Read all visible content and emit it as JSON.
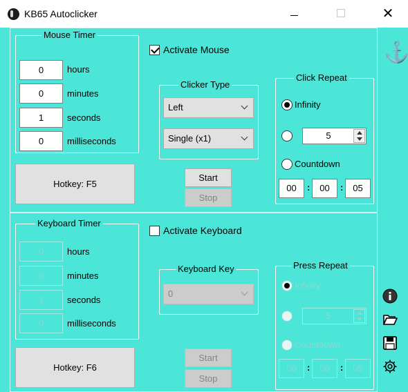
{
  "window": {
    "title": "KB65 Autoclicker",
    "close_glyph": "✕"
  },
  "mouse": {
    "timer_title": "Mouse Timer",
    "fields": [
      {
        "value": "0",
        "label": "hours"
      },
      {
        "value": "0",
        "label": "minutes"
      },
      {
        "value": "1",
        "label": "seconds"
      },
      {
        "value": "0",
        "label": "milliseconds"
      }
    ],
    "hotkey_label": "Hotkey: F5",
    "activate_label": "Activate Mouse",
    "activate_checked": true,
    "clicker_type_title": "Clicker Type",
    "button_select": "Left",
    "click_select": "Single (x1)",
    "start_label": "Start",
    "stop_label": "Stop",
    "repeat_title": "Click Repeat",
    "infinity_label": "Infinity",
    "repeat_count": "5",
    "countdown_label": "Countdown",
    "countdown": [
      "00",
      "00",
      "05"
    ],
    "time_sep": ":"
  },
  "keyboard": {
    "timer_title": "Keyboard Timer",
    "fields": [
      {
        "value": "0",
        "label": "hours"
      },
      {
        "value": "0",
        "label": "minutes"
      },
      {
        "value": "1",
        "label": "seconds"
      },
      {
        "value": "0",
        "label": "milliseconds"
      }
    ],
    "hotkey_label": "Hotkey: F6",
    "activate_label": "Activate Keyboard",
    "activate_checked": false,
    "key_title": "Keyboard Key",
    "key_select": "0",
    "start_label": "Start",
    "stop_label": "Stop",
    "repeat_title": "Press Repeat",
    "infinity_label": "Infinity",
    "repeat_count": "5",
    "countdown_label": "Countdown",
    "countdown": [
      "00",
      "00",
      "05"
    ],
    "time_sep": ":"
  },
  "icons": {
    "anchor": "anchor-icon",
    "info": "info-icon",
    "folder": "folder-open-icon",
    "save": "save-icon",
    "settings": "gear-icon"
  },
  "colors": {
    "background": "#4ce6d8",
    "titlebar": "#ffffff"
  }
}
